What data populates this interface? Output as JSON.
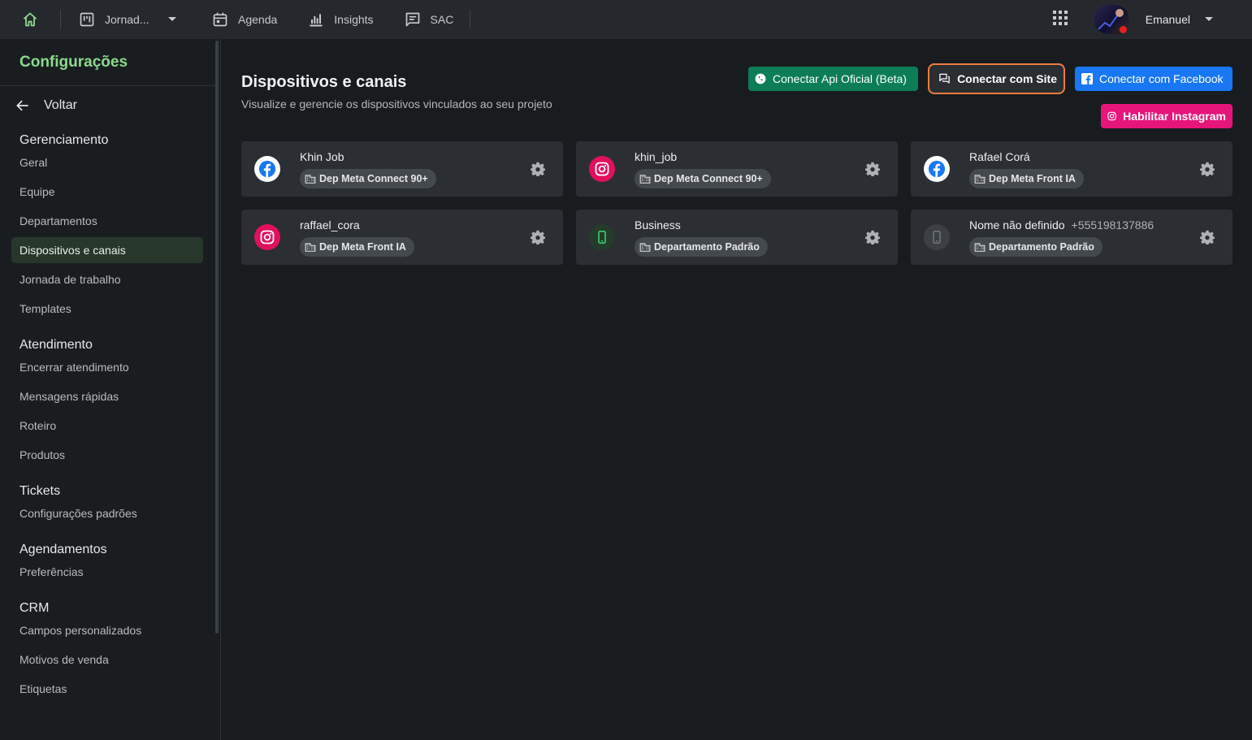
{
  "topbar": {
    "jornada_label": "Jornad...",
    "agenda_label": "Agenda",
    "insights_label": "Insights",
    "sac_label": "SAC",
    "user_name": "Emanuel"
  },
  "sidebar": {
    "title": "Configurações",
    "back_label": "Voltar",
    "sections": {
      "gerenciamento": {
        "title": "Gerenciamento",
        "items": [
          "Geral",
          "Equipe",
          "Departamentos",
          "Dispositivos e canais",
          "Jornada de trabalho",
          "Templates"
        ]
      },
      "atendimento": {
        "title": "Atendimento",
        "items": [
          "Encerrar atendimento",
          "Mensagens rápidas",
          "Roteiro",
          "Produtos"
        ]
      },
      "tickets": {
        "title": "Tickets",
        "items": [
          "Configurações padrões"
        ]
      },
      "agendamentos": {
        "title": "Agendamentos",
        "items": [
          "Preferências"
        ]
      },
      "crm": {
        "title": "CRM",
        "items": [
          "Campos personalizados",
          "Motivos de venda",
          "Etiquetas"
        ]
      }
    },
    "active_item": "Dispositivos e canais"
  },
  "main": {
    "title": "Dispositivos e canais",
    "subtitle": "Visualize e gerencie os dispositivos vinculados ao seu projeto",
    "buttons": {
      "api": "Conectar Api Oficial (Beta)",
      "site": "Conectar com Site",
      "facebook": "Conectar com Facebook",
      "instagram": "Habilitar Instagram"
    },
    "devices": [
      {
        "name": "Khin Job",
        "department": "Dep Meta Connect 90+",
        "channel": "facebook-icon"
      },
      {
        "name": "khin_job",
        "department": "Dep Meta Connect 90+",
        "channel": "instagram-icon"
      },
      {
        "name": "Rafael Corá",
        "department": "Dep Meta Front IA",
        "channel": "facebook-icon"
      },
      {
        "name": "raffael_cora",
        "department": "Dep Meta Front IA",
        "channel": "instagram-icon"
      },
      {
        "name": "Business",
        "department": "Departamento Padrão",
        "channel": "phone-icon"
      },
      {
        "name": "Nome não definido",
        "phone": "+555198137886",
        "department": "Departamento Padrão",
        "channel": "phone-disconnected-icon"
      }
    ]
  },
  "colors": {
    "accent_green": "#8cd98c",
    "api_button": "#0c7d57",
    "site_border": "#f07b3f",
    "facebook_button": "#1877f2",
    "instagram_button": "#e6157a"
  }
}
